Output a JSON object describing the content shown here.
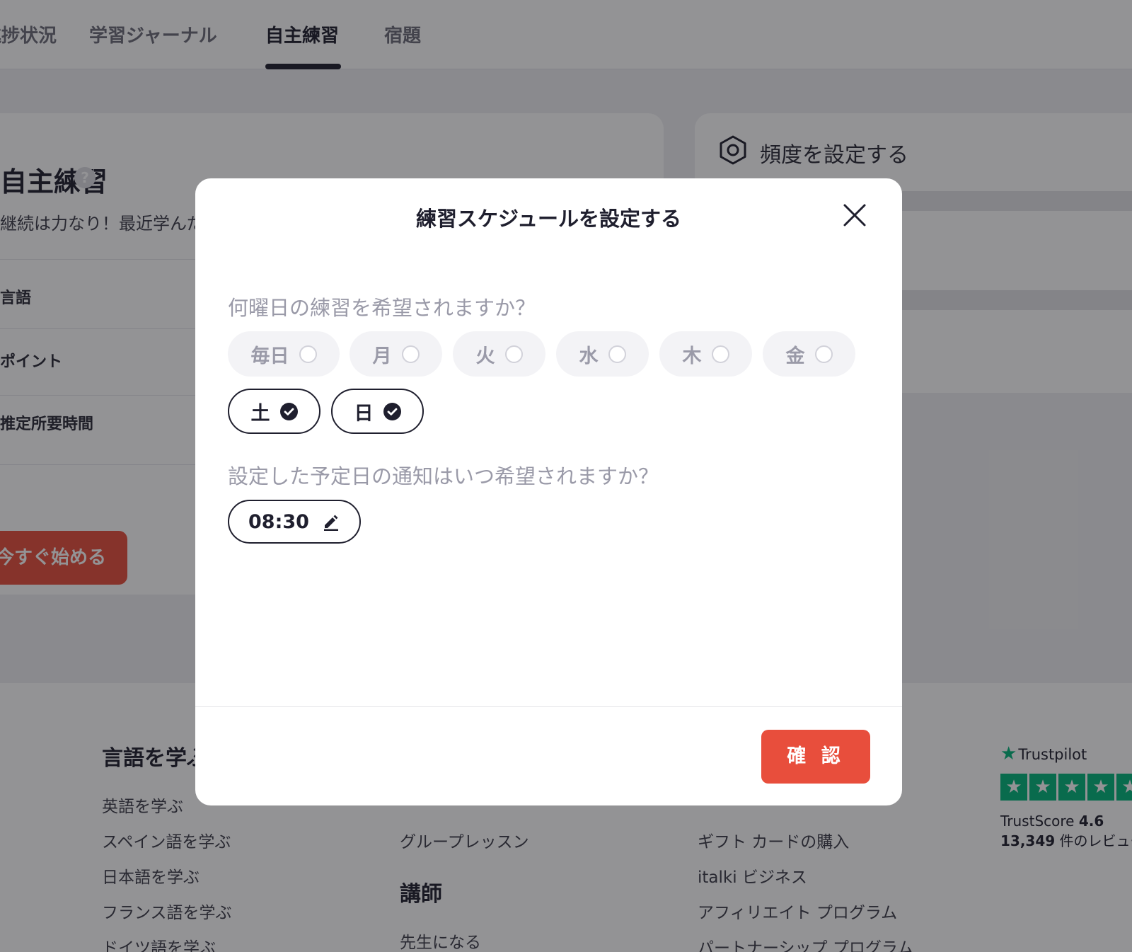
{
  "top_tabs": [
    {
      "label": "進捗状況"
    },
    {
      "label": "学習ジャーナル"
    },
    {
      "label": "自主練習"
    },
    {
      "label": "宿題"
    }
  ],
  "left_card": {
    "title": "自主練習",
    "subtitle": "継続は力なり！最近学んだこ",
    "rows": [
      "言語",
      "ポイント",
      "推定所要時間"
    ],
    "start_button": "今すぐ始める"
  },
  "right_card": {
    "title": "頻度を設定する"
  },
  "footer": {
    "col1_title": "言語を学ぶ",
    "col1_links": [
      "英語を学ぶ",
      "スペイン語を学ぶ",
      "日本語を学ぶ",
      "フランス語を学ぶ",
      "ドイツ語を学ぶ"
    ],
    "col2_links": [
      "グループレッスン"
    ],
    "col2_title": "講師",
    "col2_links_b": [
      "先生になる"
    ],
    "col3_links": [
      "ギフト カードの購入",
      "italki ビジネス",
      "アフィリエイト プログラム",
      "パートナーシップ プログラム"
    ],
    "trust_logo": "Trustpilot",
    "trust_score_label": "TrustScore",
    "trust_score": "4.6",
    "trust_count": "13,349",
    "trust_reviews": "件のレビュー"
  },
  "modal": {
    "title": "練習スケジュールを設定する",
    "question_days": "何曜日の練習を希望されますか？",
    "days": [
      {
        "label": "毎日",
        "selected": false
      },
      {
        "label": "月",
        "selected": false
      },
      {
        "label": "火",
        "selected": false
      },
      {
        "label": "水",
        "selected": false
      },
      {
        "label": "木",
        "selected": false
      },
      {
        "label": "金",
        "selected": false
      },
      {
        "label": "土",
        "selected": true
      },
      {
        "label": "日",
        "selected": true
      }
    ],
    "question_time": "設定した予定日の通知はいつ希望されますか？",
    "time": "08:30",
    "confirm": "確 認"
  },
  "colors": {
    "accent": "#e84e3c",
    "dark": "#1f1f2e",
    "muted": "#9a9aa8",
    "trustpilot": "#00b67a"
  },
  "icons": [
    "question-circle-icon",
    "settings-hexagon-icon",
    "close-icon",
    "check-icon",
    "pencil-icon",
    "trustpilot-star-icon"
  ]
}
